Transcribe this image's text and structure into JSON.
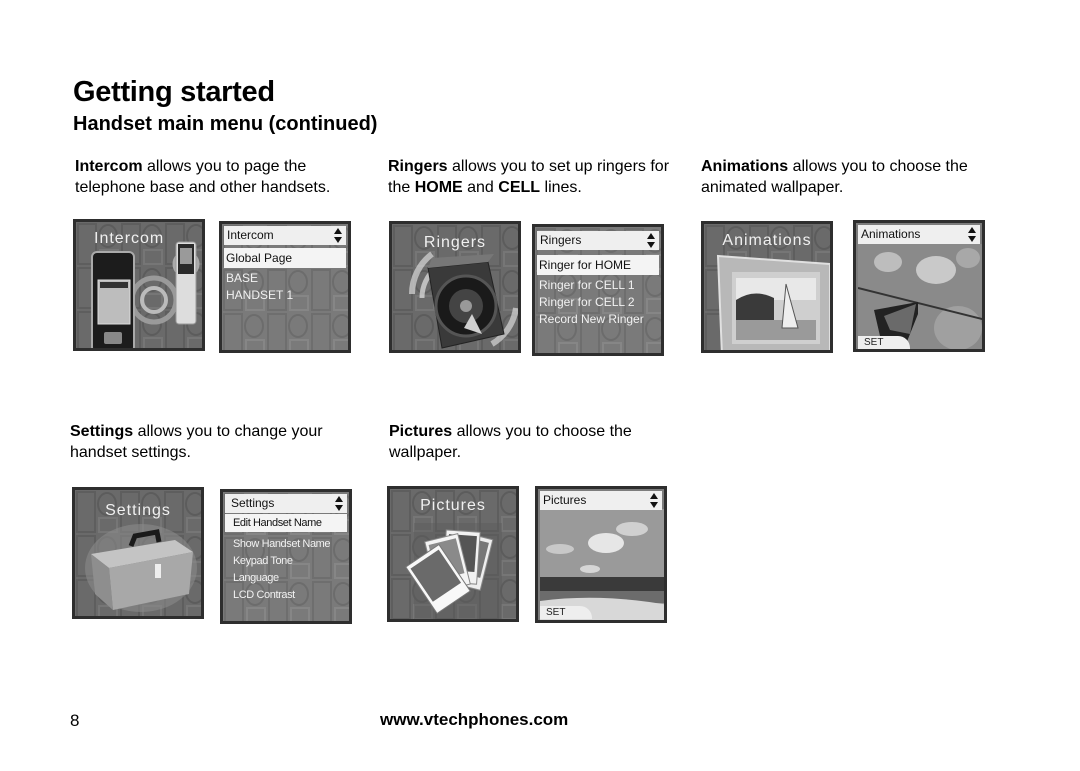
{
  "header": {
    "title": "Getting started",
    "subtitle": "Handset main menu (continued)"
  },
  "sections": {
    "intercom": {
      "desc_bold": "Intercom",
      "desc_rest": " allows you to page the telephone base and other handsets.",
      "icon_label": "Intercom",
      "menu_title": "Intercom",
      "selected_item": "Global Page",
      "items": [
        "BASE",
        "HANDSET 1"
      ]
    },
    "ringers": {
      "desc_bold": "Ringers",
      "desc_mid1": " allows you to set up ringers for the ",
      "desc_bold2": "HOME",
      "desc_mid2": " and ",
      "desc_bold3": "CELL",
      "desc_end": " lines.",
      "icon_label": "Ringers",
      "menu_title": "Ringers",
      "selected_item": "Ringer for HOME",
      "items": [
        "Ringer for CELL 1",
        "Ringer for CELL 2",
        "Record New Ringer"
      ]
    },
    "animations": {
      "desc_bold": "Animations",
      "desc_rest": " allows you to choose the animated wallpaper.",
      "icon_label": "Animations",
      "menu_title": "Animations",
      "softkey": "SET"
    },
    "settings": {
      "desc_bold": "Settings",
      "desc_rest": " allows you to change your handset settings.",
      "icon_label": "Settings",
      "menu_title": "Settings",
      "selected_item": "Edit Handset Name",
      "items": [
        "Show Handset Name",
        "Keypad Tone",
        "Language",
        "LCD Contrast"
      ]
    },
    "pictures": {
      "desc_bold": "Pictures",
      "desc_rest": " allows you to choose the wallpaper.",
      "icon_label": "Pictures",
      "menu_title": "Pictures",
      "softkey": "SET"
    }
  },
  "icons": {
    "scroll_arrows": "up-down-arrows-icon"
  },
  "footer": {
    "page_number": "8",
    "url": "www.vtechphones.com"
  }
}
